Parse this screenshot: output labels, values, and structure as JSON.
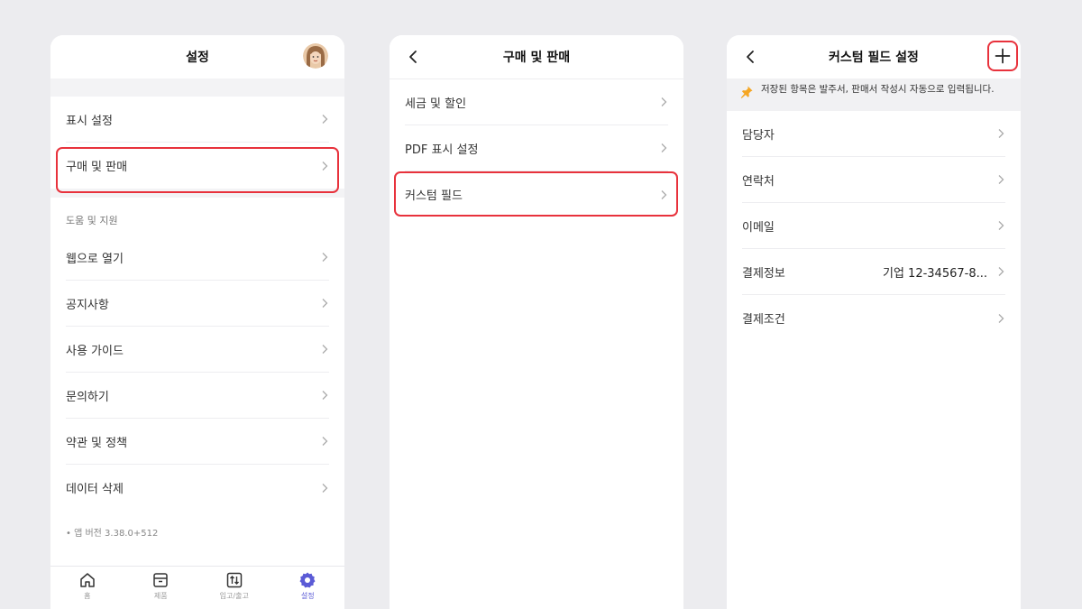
{
  "panel1": {
    "title": "설정",
    "items_top": [
      {
        "label": "표시 설정"
      },
      {
        "label": "구매 및 판매"
      }
    ],
    "section_title": "도움 및 지원",
    "items_support": [
      {
        "label": "웹으로 열기"
      },
      {
        "label": "공지사항"
      },
      {
        "label": "사용 가이드"
      },
      {
        "label": "문의하기"
      },
      {
        "label": "약관 및 정책"
      },
      {
        "label": "데이터 삭제"
      }
    ],
    "version": "• 앱 버전 3.38.0+512",
    "tabs": [
      {
        "label": "홈",
        "icon": "home-icon"
      },
      {
        "label": "제품",
        "icon": "box-icon"
      },
      {
        "label": "입고/출고",
        "icon": "in-out-icon"
      },
      {
        "label": "설정",
        "icon": "gear-icon",
        "active": true
      }
    ]
  },
  "panel2": {
    "title": "구매 및 판매",
    "items": [
      {
        "label": "세금 및 할인"
      },
      {
        "label": "PDF 표시 설정"
      },
      {
        "label": "커스텀 필드"
      }
    ]
  },
  "panel3": {
    "title": "커스텀 필드 설정",
    "notice": "저장된 항목은 발주서, 판매서 작성시 자동으로 입력됩니다.",
    "items": [
      {
        "label": "담당자",
        "value": ""
      },
      {
        "label": "연락처",
        "value": ""
      },
      {
        "label": "이메일",
        "value": ""
      },
      {
        "label": "결제정보",
        "value": "기업 12-34567-8..."
      },
      {
        "label": "결제조건",
        "value": ""
      }
    ]
  },
  "colors": {
    "highlight": "#e8323c",
    "accent": "#5b5bd6",
    "background": "#ececef"
  }
}
